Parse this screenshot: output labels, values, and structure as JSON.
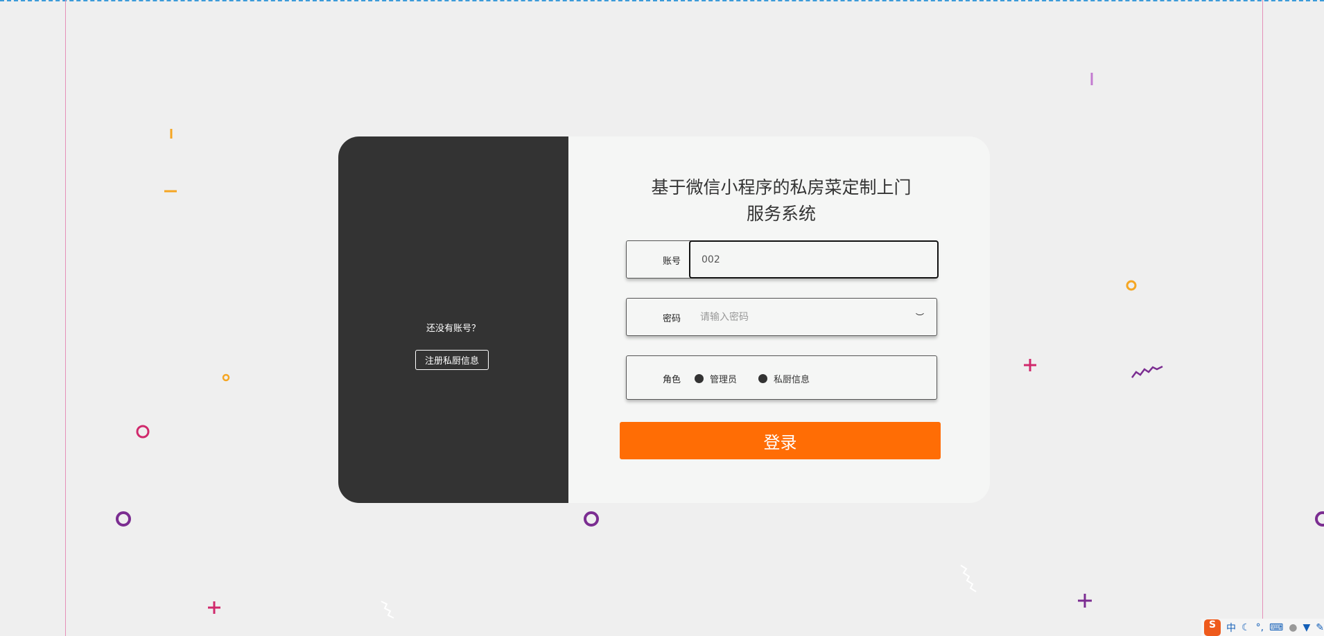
{
  "system_title_line1": "基于微信小程序的私房菜定制上门",
  "system_title_line2": "服务系统",
  "left_panel": {
    "question": "还没有账号？",
    "register_button": "注册私厨信息"
  },
  "form": {
    "account_label": "账号",
    "account_value": "002",
    "password_label": "密码",
    "password_placeholder": "请输入密码",
    "role_label": "角色",
    "roles": [
      "管理员",
      "私厨信息"
    ],
    "login_button": "登录"
  },
  "tray": {
    "ime_logo": "S",
    "ime_mode": "中",
    "items": [
      "moon-icon",
      "punctuation-icon",
      "keyboard-icon",
      "user-icon",
      "shirt-icon",
      "wrench-icon"
    ]
  },
  "colors": {
    "accent": "#ff6d05",
    "panel": "#333333"
  }
}
